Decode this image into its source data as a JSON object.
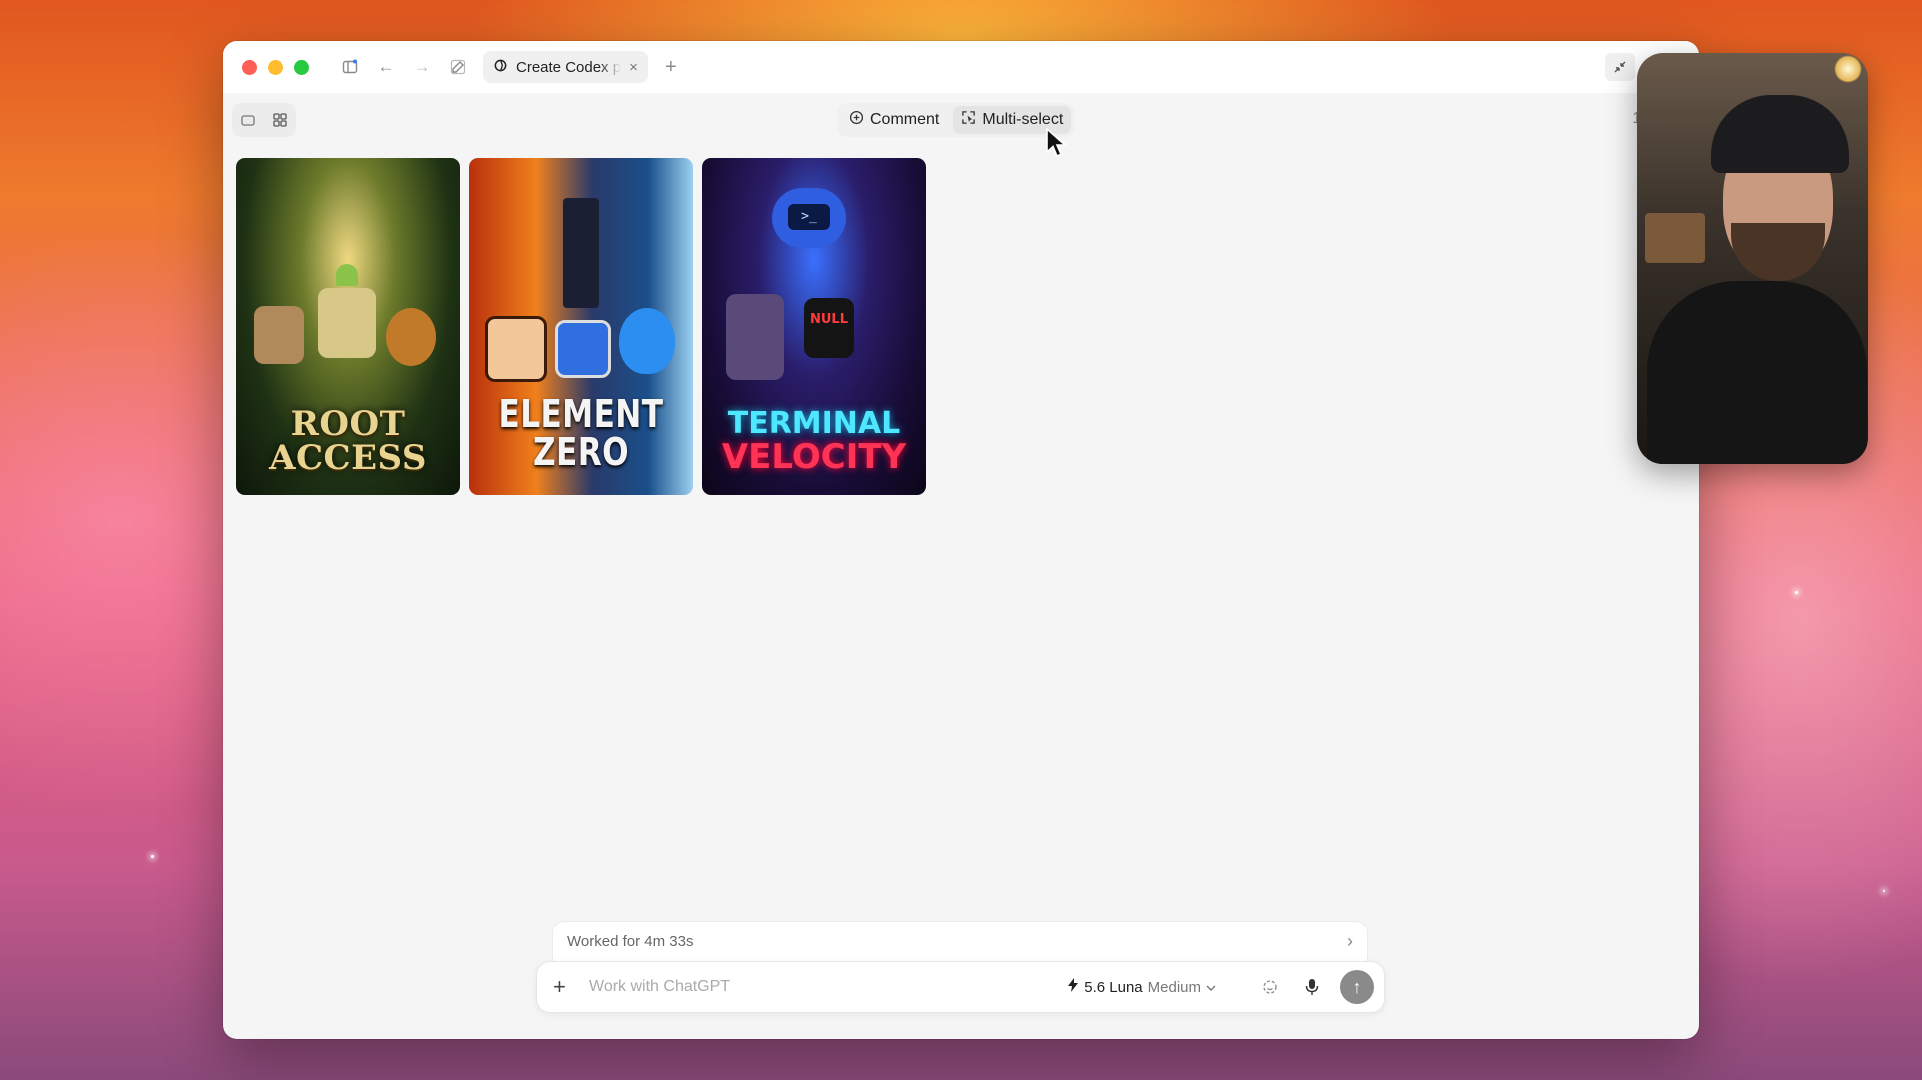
{
  "browser": {
    "tab_title": "Create Codex p",
    "tab_close": "×",
    "new_tab": "+"
  },
  "toolbar": {
    "comment_label": "Comment",
    "multiselect_label": "Multi-select",
    "zoom": "100"
  },
  "gallery": [
    {
      "title": "ROOT ACCESS",
      "title_lines": [
        "ROOT",
        "ACCESS"
      ]
    },
    {
      "title": "ELEMENT ZERO"
    },
    {
      "title": "TERMINAL VELOCITY",
      "title_lines": [
        "TERMINAL",
        "VELOCITY"
      ],
      "sign": "NULL"
    }
  ],
  "status": {
    "worked": "Worked for 4m 33s",
    "chevron": "›"
  },
  "composer": {
    "placeholder": "Work with ChatGPT",
    "model": "5.6 Luna",
    "effort": "Medium"
  },
  "icons": {
    "sidebar": "sidebar-icon",
    "back": "arrow-left-icon",
    "forward": "arrow-right-icon",
    "edit": "compose-icon",
    "collapse": "collapse-icon"
  }
}
